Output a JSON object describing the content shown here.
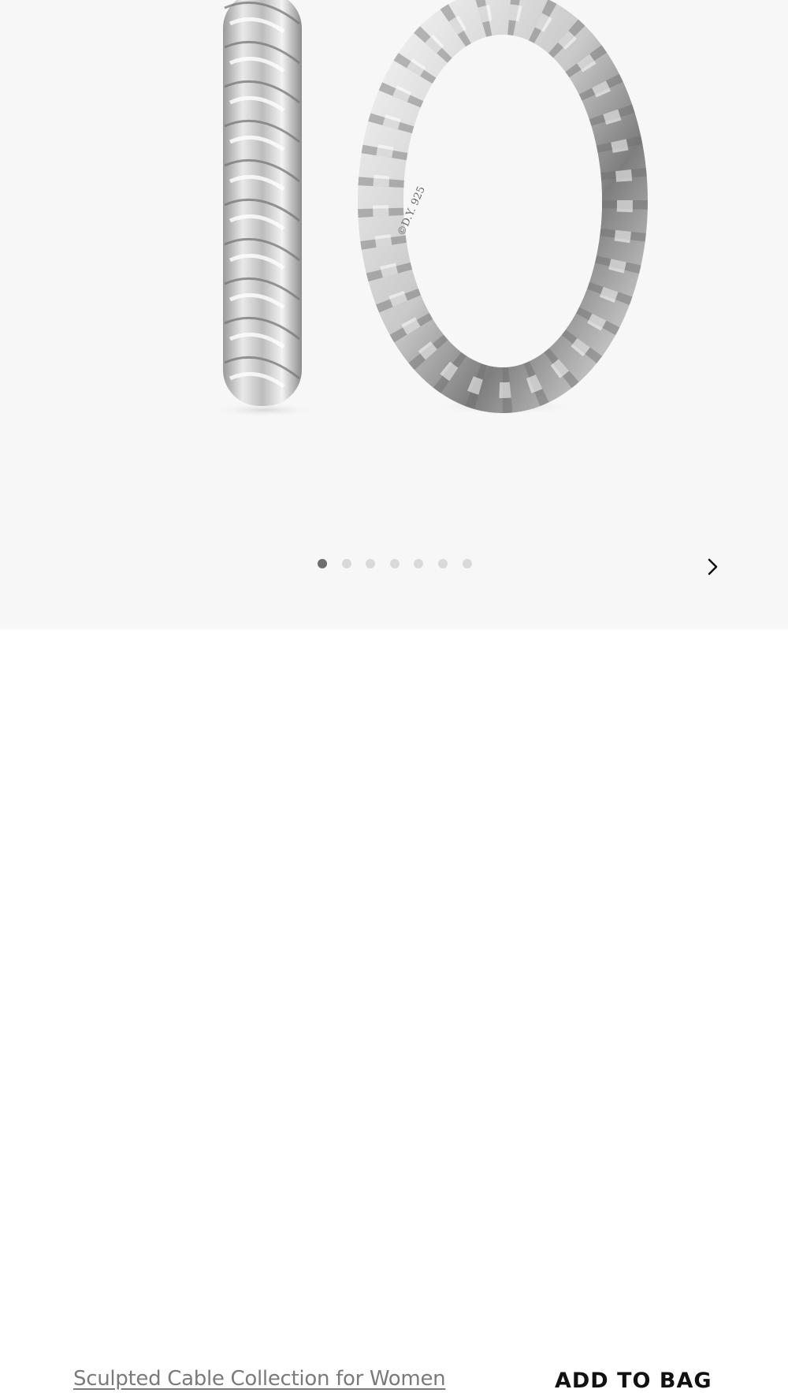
{
  "gallery": {
    "image_alt": "Sculpted Cable hoop earrings in sterling silver",
    "engraving": "©D.Y. 925",
    "dots_total": 7,
    "active_index": 0,
    "colors": {
      "active_dot": "#6e6e6e",
      "inactive_dot": "#d9d9d9",
      "background": "#f7f7f7"
    },
    "next_icon": "chevron-right-icon"
  },
  "footer": {
    "collection_link": "Sculpted Cable Collection for Women",
    "add_to_bag": "ADD TO BAG"
  }
}
